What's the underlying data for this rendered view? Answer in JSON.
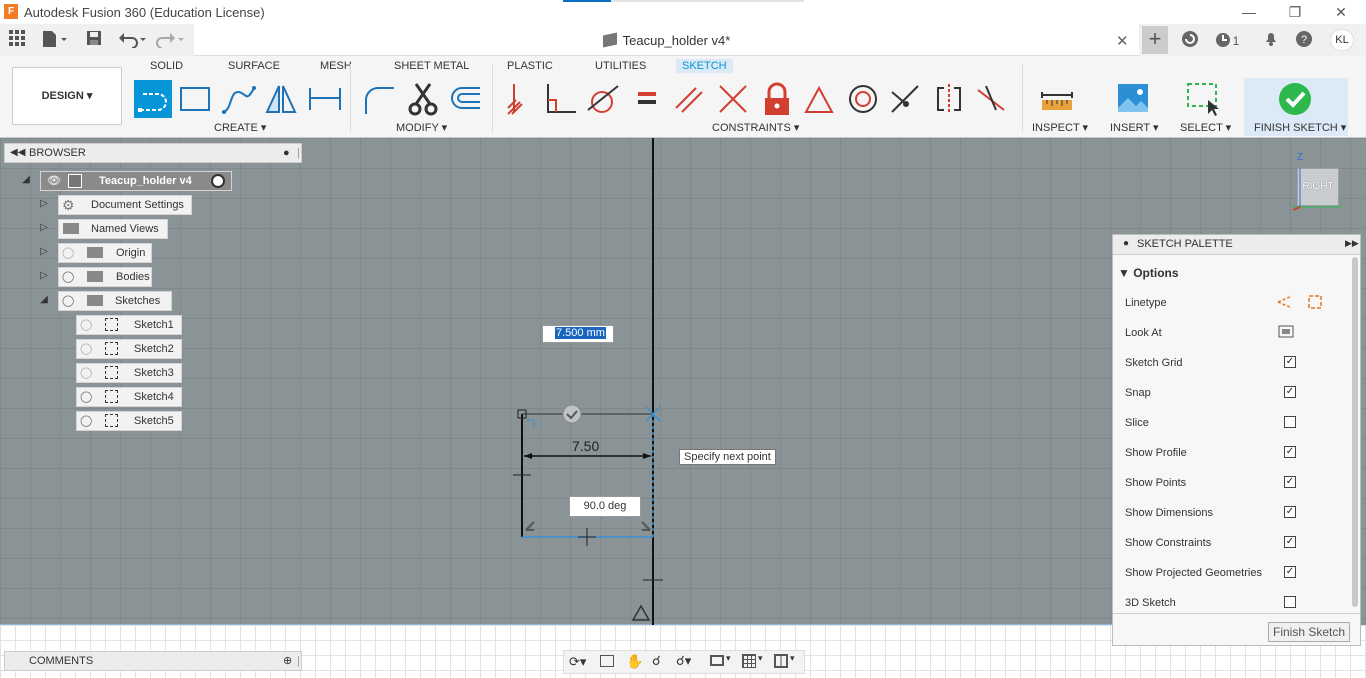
{
  "app": {
    "title": "Autodesk Fusion 360 (Education License)",
    "icon": "F"
  },
  "doc": {
    "tab_title": "Teacup_holder v4*",
    "jobs": "1",
    "user": "KL"
  },
  "workspace": "DESIGN",
  "tabs": [
    "SOLID",
    "SURFACE",
    "MESH",
    "SHEET METAL",
    "PLASTIC",
    "UTILITIES",
    "SKETCH"
  ],
  "groups": {
    "create": "CREATE",
    "modify": "MODIFY",
    "constraints": "CONSTRAINTS",
    "inspect": "INSPECT",
    "insert": "INSERT",
    "select": "SELECT",
    "finish": "FINISH SKETCH"
  },
  "browser": {
    "title": "BROWSER",
    "root": "Teacup_holder v4",
    "items": [
      {
        "label": "Document Settings",
        "icon": "gear-icon"
      },
      {
        "label": "Named Views",
        "icon": "folder-icon"
      },
      {
        "label": "Origin",
        "icon": "folder-icon"
      },
      {
        "label": "Bodies",
        "icon": "folder-icon"
      },
      {
        "label": "Sketches",
        "icon": "folder-icon"
      }
    ],
    "sketches": [
      "Sketch1",
      "Sketch2",
      "Sketch3",
      "Sketch4",
      "Sketch5"
    ]
  },
  "canvas": {
    "dimension_input": "7.500 mm",
    "dimension_label": "7.50",
    "angle_label": "90.0 deg",
    "tooltip": "Specify next point"
  },
  "viewcube": {
    "face": "RIGHT",
    "axis_z": "Z"
  },
  "palette": {
    "title": "SKETCH PALETTE",
    "section": "Options",
    "rows": [
      {
        "label": "Linetype",
        "type": "icons"
      },
      {
        "label": "Look At",
        "type": "icon"
      },
      {
        "label": "Sketch Grid",
        "checked": true
      },
      {
        "label": "Snap",
        "checked": true
      },
      {
        "label": "Slice",
        "checked": false
      },
      {
        "label": "Show Profile",
        "checked": true
      },
      {
        "label": "Show Points",
        "checked": true
      },
      {
        "label": "Show Dimensions",
        "checked": true
      },
      {
        "label": "Show Constraints",
        "checked": true
      },
      {
        "label": "Show Projected Geometries",
        "checked": true
      },
      {
        "label": "3D Sketch",
        "checked": false
      }
    ],
    "finish_button": "Finish Sketch"
  },
  "comments": {
    "title": "COMMENTS"
  },
  "colors": {
    "accent": "#0696d7",
    "finish_green": "#2db84b",
    "constraint_red": "#d23f31"
  }
}
